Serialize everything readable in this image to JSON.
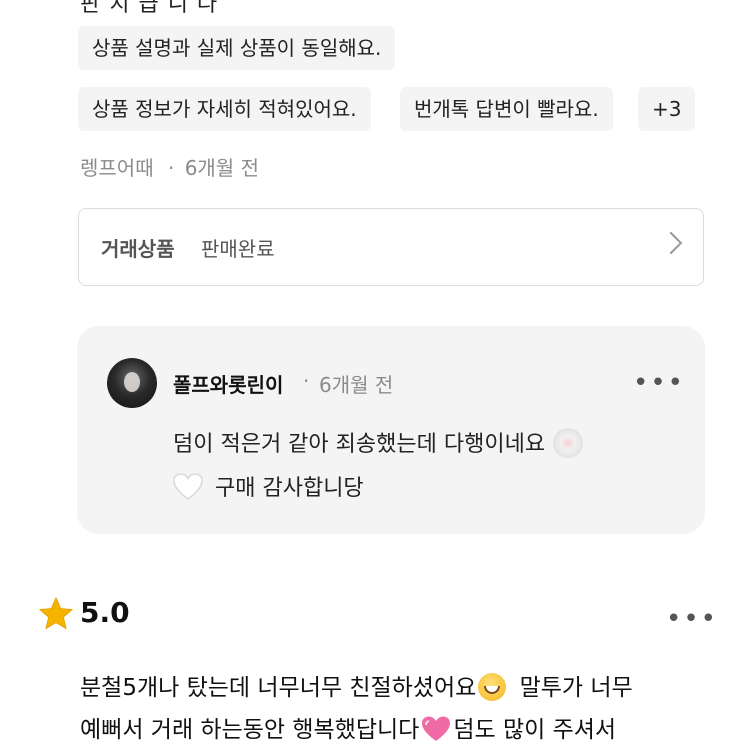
{
  "top_partial_text": "판 치 급 니 다",
  "tags": [
    "상품 설명과 실제 상품이 동일해요.",
    "상품 정보가 자세히 적혀있어요.",
    "번개톡 답변이 빨라요.",
    "+3"
  ],
  "review_meta": {
    "author": "렝프어때",
    "separator": "·",
    "time": "6개월 전"
  },
  "trade": {
    "label": "거래상품",
    "status": "판매완료"
  },
  "reply": {
    "author": "폴프와롯린이",
    "separator": "·",
    "time": "6개월 전",
    "line1": "덤이 적은거 같아 죄송했는데 다행이네요",
    "line2": "구매 감사합니당",
    "icons": [
      "cake-emoji",
      "white-heart-emoji"
    ]
  },
  "next_review": {
    "rating": "5.0",
    "line1_a": "분철5개나 탔는데 너무너무 친절하셨어요",
    "line1_b": "말투가 너무",
    "line2_a": "예뻐서 거래 하는동안 행복했답니다",
    "line2_b": "덤도 많이 주셔서",
    "icons": [
      "star-icon",
      "grinning-face-emoji",
      "pink-heart-emoji"
    ]
  },
  "colors": {
    "chip_bg": "#f4f4f5",
    "reply_bg": "#f4f4f5",
    "meta_text": "#8b8b8b",
    "star": "#f5b400"
  }
}
